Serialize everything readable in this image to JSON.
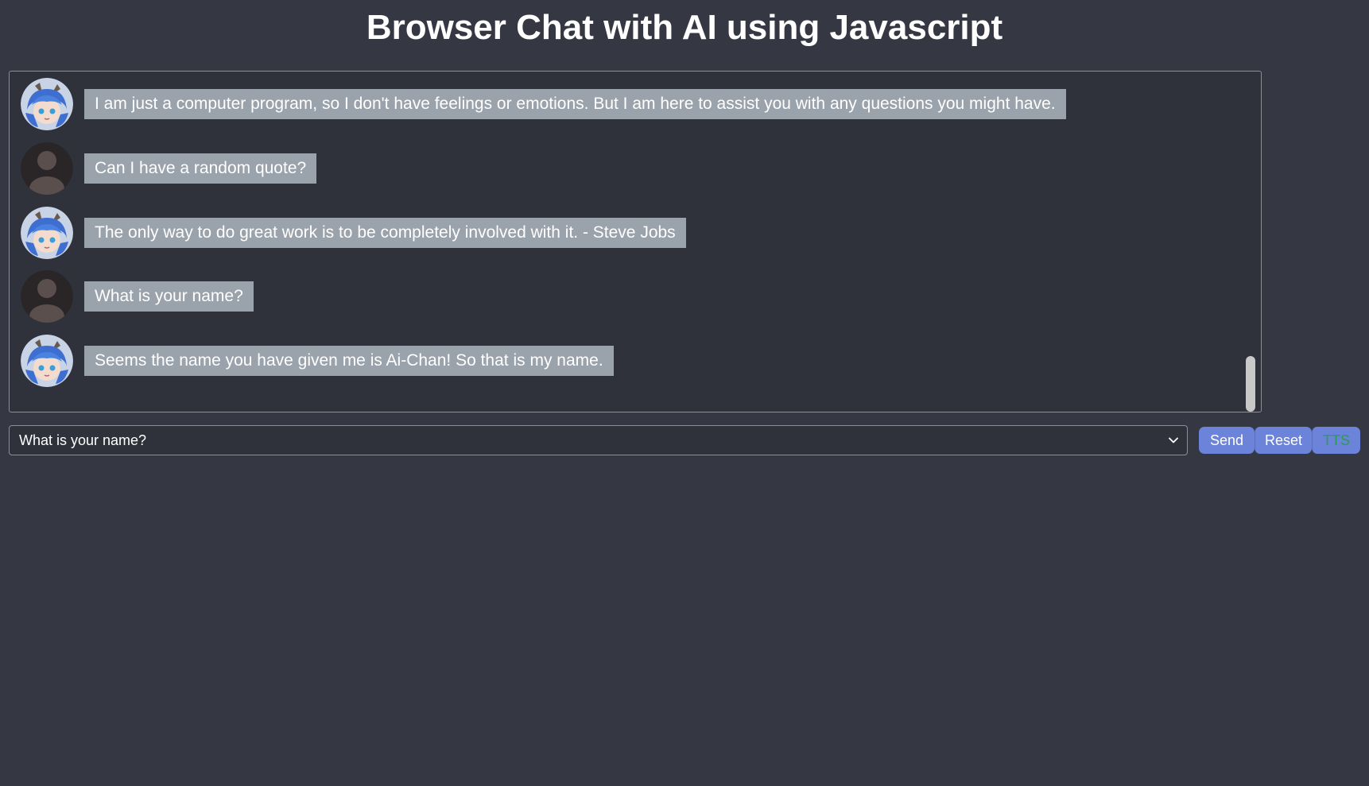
{
  "page": {
    "title": "Browser Chat with AI using Javascript"
  },
  "chat": {
    "messages": [
      {
        "sender": "ai",
        "avatar_icon": "anime-girl-avatar-icon",
        "text": "I am just a computer program, so I don't have feelings or emotions. But I am here to assist you with any questions you might have."
      },
      {
        "sender": "user",
        "avatar_icon": "default-user-avatar-icon",
        "text": "Can I have a random quote?"
      },
      {
        "sender": "ai",
        "avatar_icon": "anime-girl-avatar-icon",
        "text": "The only way to do great work is to be completely involved with it. - Steve Jobs"
      },
      {
        "sender": "user",
        "avatar_icon": "default-user-avatar-icon",
        "text": "What is your name?"
      },
      {
        "sender": "ai",
        "avatar_icon": "anime-girl-avatar-icon",
        "text": "Seems the name you have given me is Ai-Chan! So that is my name."
      }
    ]
  },
  "input": {
    "selected": "What is your name?",
    "dropdown_icon": "chevron-down-icon"
  },
  "buttons": {
    "send": "Send",
    "reset": "Reset",
    "tts": "TTS"
  },
  "colors": {
    "background": "#353842",
    "chat_background": "#30323b",
    "bubble": "#9aa2ab",
    "button": "#6b83d8",
    "tts_text": "#2e9a5a"
  }
}
